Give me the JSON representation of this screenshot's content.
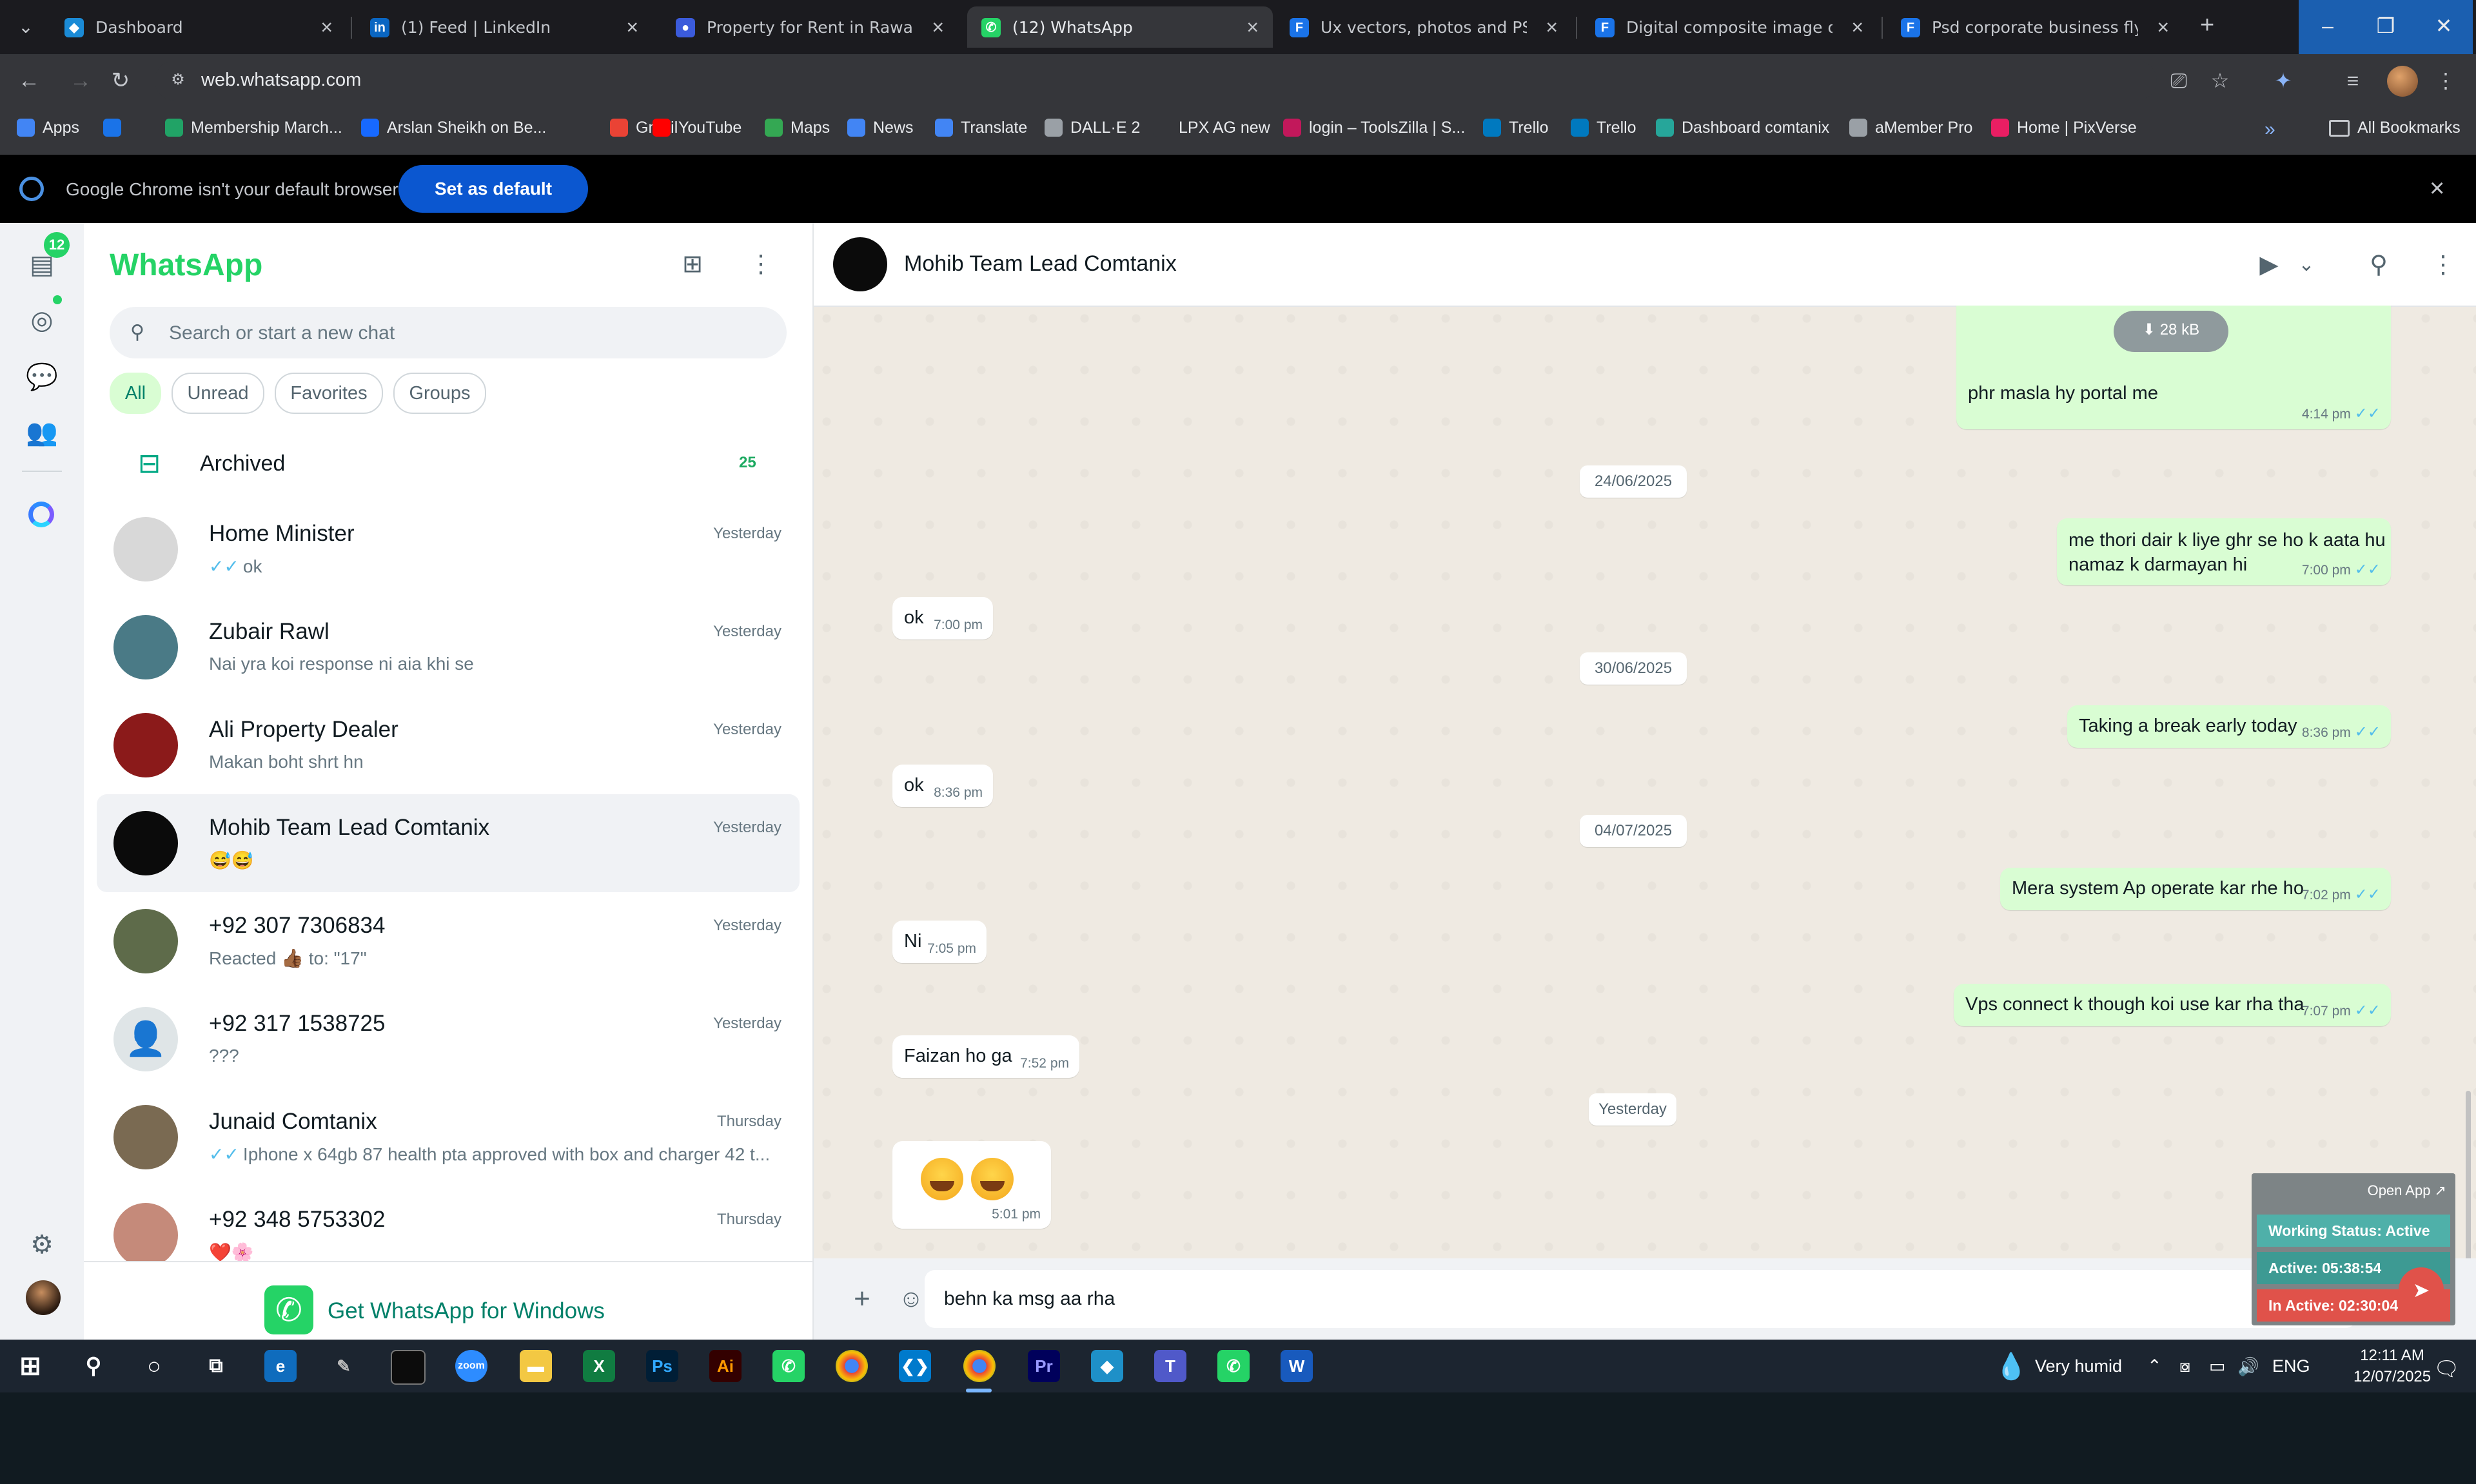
{
  "browser": {
    "tabs": [
      {
        "title": "Dashboard",
        "fav_color": "#1b8bd6",
        "fav_glyph": "◆"
      },
      {
        "title": "(1) Feed | LinkedIn",
        "fav_color": "#0a66c2",
        "fav_glyph": "in"
      },
      {
        "title": "Property for Rent in Rawalpindi",
        "fav_color": "#3b5bdb",
        "fav_glyph": "●"
      },
      {
        "title": "(12) WhatsApp",
        "fav_color": "#25d366",
        "fav_glyph": "✆"
      },
      {
        "title": "Ux vectors, photos and PSD files",
        "fav_color": "#1a73e8",
        "fav_glyph": "F"
      },
      {
        "title": "Digital composite image of gra",
        "fav_color": "#1a73e8",
        "fav_glyph": "F"
      },
      {
        "title": "Psd corporate business flyer de",
        "fav_color": "#1a73e8",
        "fav_glyph": "F"
      }
    ],
    "url": "web.whatsapp.com",
    "bookmarks": [
      {
        "label": "Apps",
        "color": "#4285f4"
      },
      {
        "label": "",
        "color": "#1a73e8"
      },
      {
        "label": "Membership March...",
        "color": "#21a366"
      },
      {
        "label": "Arslan Sheikh on Be...",
        "color": "#1769ff"
      },
      {
        "label": "Gmail",
        "color": "#ea4335"
      },
      {
        "label": "YouTube",
        "color": "#ff0000"
      },
      {
        "label": "Maps",
        "color": "#34a853"
      },
      {
        "label": "News",
        "color": "#4285f4"
      },
      {
        "label": "Translate",
        "color": "#4285f4"
      },
      {
        "label": "DALL·E 2",
        "color": "#9aa0a6"
      },
      {
        "label": "LPX AG new",
        "color": "#35363a"
      },
      {
        "label": "login – ToolsZilla | S...",
        "color": "#c2185b"
      },
      {
        "label": "Trello",
        "color": "#0079bf"
      },
      {
        "label": "Trello",
        "color": "#0079bf"
      },
      {
        "label": "Dashboard comtanix",
        "color": "#26a69a"
      },
      {
        "label": "aMember Pro",
        "color": "#9aa0a6"
      },
      {
        "label": "Home | PixVerse",
        "color": "#e91e63"
      }
    ],
    "all_bookmarks": "All Bookmarks",
    "infobar": {
      "text": "Google Chrome isn't your default browser",
      "button": "Set as default"
    }
  },
  "rail": {
    "unread_badge": "12"
  },
  "sidebar": {
    "title": "WhatsApp",
    "search_placeholder": "Search or start a new chat",
    "filters": [
      "All",
      "Unread",
      "Favorites",
      "Groups"
    ],
    "archived": {
      "label": "Archived",
      "count": "25"
    },
    "chats": [
      {
        "name": "Home Minister",
        "time": "Yesterday",
        "preview": "ok",
        "ticks": true,
        "avatar": "#d8d8d8"
      },
      {
        "name": "Zubair Rawl",
        "time": "Yesterday",
        "preview": "Nai yra koi response ni aia khi se",
        "ticks": false,
        "avatar": "#4a7a86"
      },
      {
        "name": "Ali Property Dealer",
        "time": "Yesterday",
        "preview": "Makan boht shrt hn",
        "ticks": false,
        "avatar": "#8b1a1a"
      },
      {
        "name": "Mohib Team Lead Comtanix",
        "time": "Yesterday",
        "preview": "😅😅",
        "ticks": false,
        "avatar": "#0b0b0b"
      },
      {
        "name": "+92 307 7306834",
        "time": "Yesterday",
        "preview": "Reacted 👍🏾 to: \"17\"",
        "ticks": false,
        "avatar": "#5e6b4a"
      },
      {
        "name": "+92 317 1538725",
        "time": "Yesterday",
        "preview": "???",
        "ticks": false,
        "avatar": "#dfe5e7"
      },
      {
        "name": "Junaid Comtanix",
        "time": "Thursday",
        "preview": "Iphone x 64gb 87 health pta approved with box and charger   42 t...",
        "ticks": true,
        "avatar": "#7a6a52"
      },
      {
        "name": "+92 348 5753302",
        "time": "Thursday",
        "preview": "❤️🌸",
        "ticks": false,
        "avatar": "#c58a7a"
      }
    ],
    "get_app": "Get WhatsApp for Windows"
  },
  "chat": {
    "contact": "Mohib Team Lead Comtanix",
    "download_size": "28 kB",
    "messages": [
      {
        "dir": "out",
        "text": "phr masla hy portal me",
        "time": "4:14 pm"
      },
      {
        "dir": "date",
        "text": "24/06/2025"
      },
      {
        "dir": "out",
        "text": "me thori dair k liye ghr se ho k aata hu",
        "text2": "namaz k darmayan hi",
        "time": "7:00 pm"
      },
      {
        "dir": "in",
        "text": "ok",
        "time": "7:00 pm"
      },
      {
        "dir": "date",
        "text": "30/06/2025"
      },
      {
        "dir": "out",
        "text": "Taking a break early today",
        "time": "8:36 pm"
      },
      {
        "dir": "in",
        "text": "ok",
        "time": "8:36 pm"
      },
      {
        "dir": "date",
        "text": "04/07/2025"
      },
      {
        "dir": "out",
        "text": "Mera system Ap operate kar rhe ho",
        "time": "7:02 pm"
      },
      {
        "dir": "in",
        "text": "Ni",
        "time": "7:05 pm"
      },
      {
        "dir": "out",
        "text": "Vps connect k though koi use kar rha tha",
        "time": "7:07 pm"
      },
      {
        "dir": "in",
        "text": "Faizan ho ga",
        "time": "7:52 pm"
      },
      {
        "dir": "date",
        "text": "Yesterday"
      },
      {
        "dir": "in",
        "text": "😅😅",
        "time": "5:01 pm"
      }
    ],
    "composer_text": "behn ka msg aa rha"
  },
  "widget": {
    "open_app": "Open App ↗",
    "status": "Working Status: Active",
    "active": "Active: 05:38:54",
    "inactive": "In Active: 02:30:04"
  },
  "taskbar": {
    "weather": "Very humid",
    "lang": "ENG",
    "time": "12:11 AM",
    "date": "12/07/2025"
  }
}
